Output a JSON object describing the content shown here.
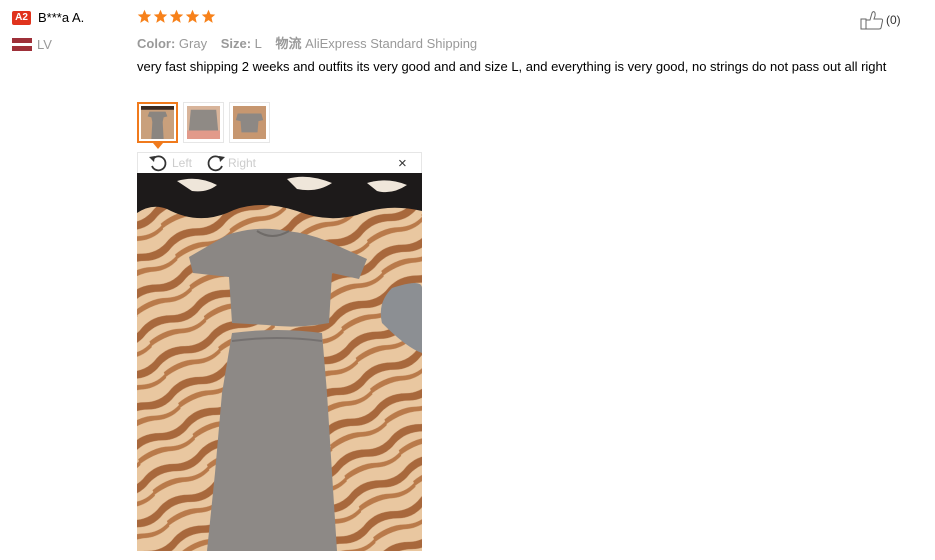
{
  "reviewer": {
    "level_badge": "A2",
    "name": "B***a A.",
    "country": "LV",
    "flag_colors": [
      "#9e3039",
      "#ffffff",
      "#9e3039"
    ]
  },
  "review": {
    "rating": 5,
    "rating_max": 5,
    "star_color": "#f7811a",
    "color_key": "Color:",
    "color_value": "Gray",
    "size_key": "Size:",
    "size_value": "L",
    "shipping_key": "物流",
    "shipping_value": "AliExpress Standard Shipping",
    "text": "very fast shipping 2 weeks and outfits its very good and and size L, and everything is very good, no strings do not pass out all right",
    "helpful_count": "(0)"
  },
  "thumbnails": {
    "count": 3,
    "active_index": 0,
    "accent_color": "#f07a1c"
  },
  "viewer": {
    "rotate_left_label": "Left",
    "rotate_right_label": "Right",
    "close_glyph": "×"
  }
}
